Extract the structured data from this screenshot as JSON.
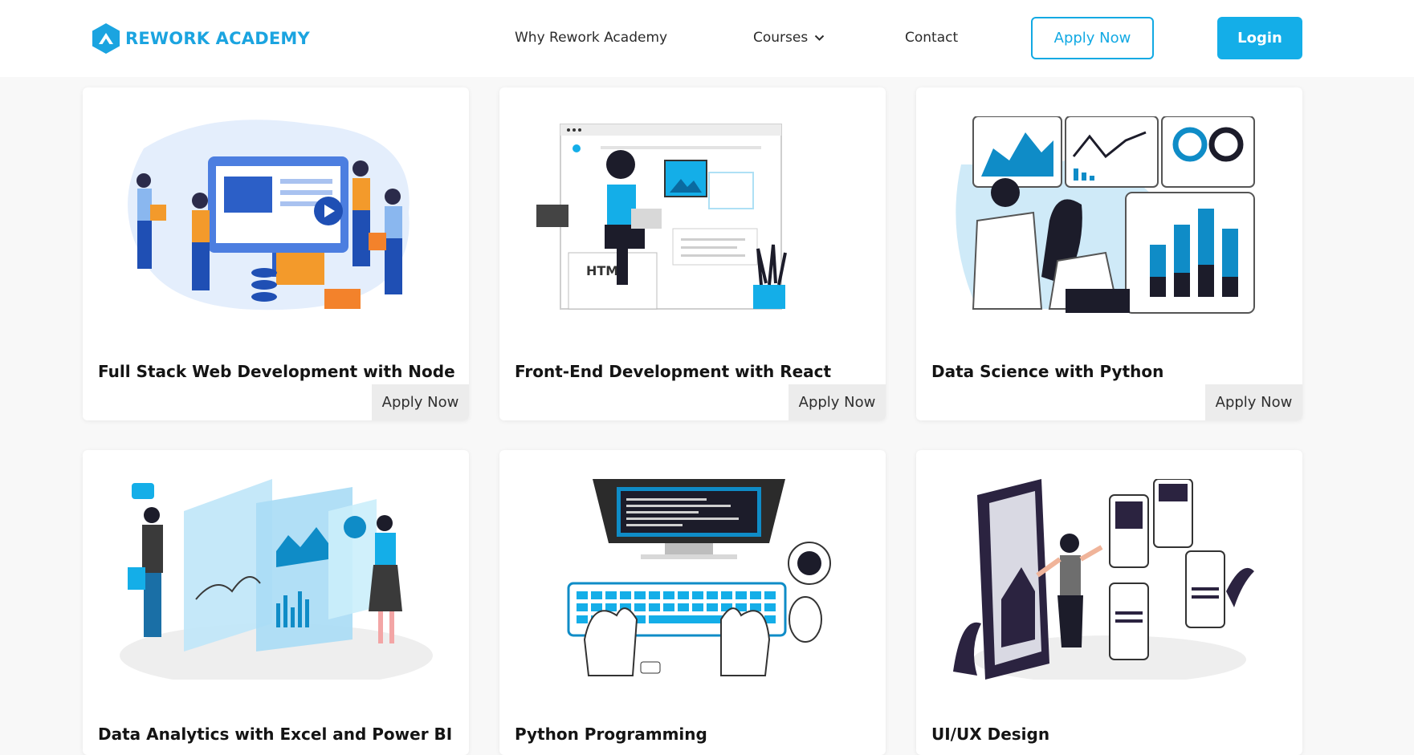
{
  "brand": {
    "name": "REWORK ACADEMY",
    "color": "#1ba4e0"
  },
  "nav": {
    "why": "Why Rework Academy",
    "courses": "Courses",
    "contact": "Contact",
    "apply": "Apply Now",
    "login": "Login"
  },
  "courses": [
    {
      "title": "Full Stack Web Development with Node",
      "apply": "Apply Now",
      "illustration": "team-web-development-illustration"
    },
    {
      "title": "Front-End Development with React",
      "apply": "Apply Now",
      "illustration": "woman-html-coding-illustration"
    },
    {
      "title": "Data Science with Python",
      "apply": "Apply Now",
      "illustration": "data-scientists-dashboard-illustration"
    },
    {
      "title": "Data Analytics with Excel and Power BI",
      "illustration": "analytics-screens-illustration"
    },
    {
      "title": "Python Programming",
      "illustration": "laptop-keyboard-coding-illustration"
    },
    {
      "title": "UI/UX Design",
      "illustration": "mobile-app-design-illustration"
    }
  ],
  "colors": {
    "accent": "#14aee8",
    "dark": "#141414"
  }
}
